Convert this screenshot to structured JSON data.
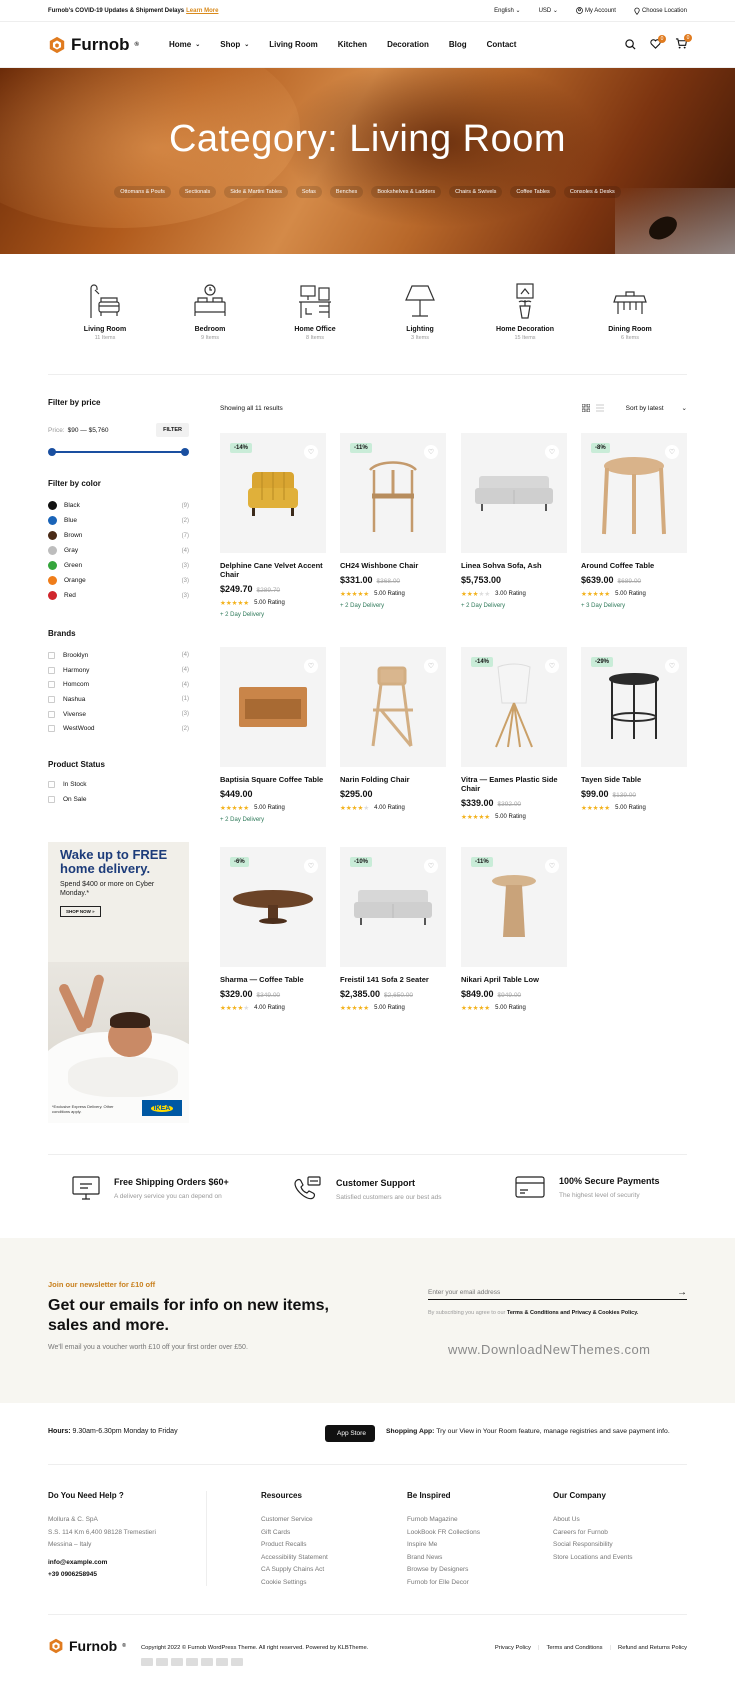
{
  "topbar": {
    "notice": "Furnob's COVID-19 Updates & Shipment Delays",
    "learn_more": "Learn More",
    "language": "English",
    "currency": "USD",
    "account": "My Account",
    "location": "Choose Location"
  },
  "header": {
    "logo": "Furnob",
    "nav": [
      "Home",
      "Shop",
      "Living Room",
      "Kitchen",
      "Decoration",
      "Blog",
      "Contact"
    ],
    "wishlist_count": "0",
    "cart_count": "0"
  },
  "hero": {
    "title": "Category: Living Room",
    "subcategories": [
      "Ottomans & Poufs",
      "Sectionals",
      "Side & Martini Tables",
      "Sofas",
      "Benches",
      "Bookshelves & Ladders",
      "Chairs & Swivels",
      "Coffee Tables",
      "Consoles & Desks"
    ]
  },
  "categories": [
    {
      "name": "Living Room",
      "count": "11 Items",
      "icon": "armchair-lamp-icon"
    },
    {
      "name": "Bedroom",
      "count": "9 Items",
      "icon": "bed-clock-icon"
    },
    {
      "name": "Home Office",
      "count": "8 Items",
      "icon": "desk-icon"
    },
    {
      "name": "Lighting",
      "count": "3 Items",
      "icon": "lamp-icon"
    },
    {
      "name": "Home Decoration",
      "count": "15 Items",
      "icon": "plant-frame-icon"
    },
    {
      "name": "Dining Room",
      "count": "6 Items",
      "icon": "dining-table-icon"
    }
  ],
  "sidebar": {
    "price": {
      "title": "Filter by price",
      "label": "Price:",
      "range": "$90 — $5,760",
      "button": "FILTER",
      "min_fraction": 0.0,
      "max_fraction": 1.0
    },
    "color": {
      "title": "Filter by color",
      "items": [
        {
          "name": "Black",
          "count": "(9)",
          "hex": "#111111"
        },
        {
          "name": "Blue",
          "count": "(2)",
          "hex": "#1a64b8"
        },
        {
          "name": "Brown",
          "count": "(7)",
          "hex": "#4a2b17"
        },
        {
          "name": "Gray",
          "count": "(4)",
          "hex": "#bdbdbd"
        },
        {
          "name": "Green",
          "count": "(3)",
          "hex": "#35a53c"
        },
        {
          "name": "Orange",
          "count": "(3)",
          "hex": "#ef7d1a"
        },
        {
          "name": "Red",
          "count": "(3)",
          "hex": "#d0262d"
        }
      ]
    },
    "brands": {
      "title": "Brands",
      "items": [
        {
          "name": "Brooklyn",
          "count": "(4)"
        },
        {
          "name": "Harmony",
          "count": "(4)"
        },
        {
          "name": "Homcom",
          "count": "(4)"
        },
        {
          "name": "Nashua",
          "count": "(1)"
        },
        {
          "name": "Vivense",
          "count": "(3)"
        },
        {
          "name": "WestWood",
          "count": "(2)"
        }
      ]
    },
    "status": {
      "title": "Product Status",
      "items": [
        "In Stock",
        "On Sale"
      ]
    },
    "banner": {
      "title": "Wake up to FREE home delivery.",
      "text": "Spend $400 or more on Cyber Monday.*",
      "button": "SHOP NOW »",
      "fine_print": "*Exclusive Express Delivery. Other conditions apply.",
      "brand": "IKEA"
    }
  },
  "toolbar": {
    "results": "Showing all 11 results",
    "sort": "Sort by latest"
  },
  "products": [
    {
      "name": "Delphine Cane Velvet Accent Chair",
      "price": "$249.70",
      "old_price": "$289.70",
      "discount": "-14%",
      "rating": 5,
      "rating_text": "5.00 Rating",
      "delivery": "+ 2 Day Delivery",
      "art": "yellow-armchair"
    },
    {
      "name": "CH24 Wishbone Chair",
      "price": "$331.00",
      "old_price": "$368.00",
      "discount": "-11%",
      "rating": 5,
      "rating_text": "5.00 Rating",
      "delivery": "+ 2 Day Delivery",
      "art": "wishbone-chair"
    },
    {
      "name": "Linea Sohva Sofa, Ash",
      "price": "$5,753.00",
      "old_price": "",
      "discount": "",
      "rating": 3,
      "rating_text": "3.00 Rating",
      "delivery": "+ 2 Day Delivery",
      "art": "gray-sofa"
    },
    {
      "name": "Around Coffee Table",
      "price": "$639.00",
      "old_price": "$689.00",
      "discount": "-8%",
      "rating": 5,
      "rating_text": "5.00 Rating",
      "delivery": "+ 3 Day Delivery",
      "art": "round-table"
    },
    {
      "name": "Baptisia Square Coffee Table",
      "price": "$449.00",
      "old_price": "",
      "discount": "",
      "rating": 5,
      "rating_text": "5.00 Rating",
      "delivery": "+ 2 Day Delivery",
      "art": "square-table"
    },
    {
      "name": "Narin Folding Chair",
      "price": "$295.00",
      "old_price": "",
      "discount": "",
      "rating": 4,
      "rating_text": "4.00 Rating",
      "delivery": "",
      "art": "folding-chair"
    },
    {
      "name": "Vitra — Eames Plastic Side Chair",
      "price": "$339.00",
      "old_price": "$392.00",
      "discount": "-14%",
      "rating": 5,
      "rating_text": "5.00 Rating",
      "delivery": "",
      "art": "eames-chair"
    },
    {
      "name": "Tayen Side Table",
      "price": "$99.00",
      "old_price": "$139.00",
      "discount": "-29%",
      "rating": 5,
      "rating_text": "5.00 Rating",
      "delivery": "",
      "art": "side-table"
    },
    {
      "name": "Sharma — Coffee Table",
      "price": "$329.00",
      "old_price": "$349.00",
      "discount": "-6%",
      "rating": 4,
      "rating_text": "4.00 Rating",
      "delivery": "",
      "art": "oval-table"
    },
    {
      "name": "Freistil 141 Sofa 2 Seater",
      "price": "$2,385.00",
      "old_price": "$2,650.00",
      "discount": "-10%",
      "rating": 5,
      "rating_text": "5.00 Rating",
      "delivery": "",
      "art": "gray-sofa"
    },
    {
      "name": "Nikari April Table Low",
      "price": "$849.00",
      "old_price": "$949.00",
      "discount": "-11%",
      "rating": 5,
      "rating_text": "5.00 Rating",
      "delivery": "",
      "art": "wood-stool"
    }
  ],
  "features": [
    {
      "title": "Free Shipping Orders $60+",
      "text": "A delivery service you can depend on",
      "icon": "monitor-icon"
    },
    {
      "title": "Customer Support",
      "text": "Satisfied customers are our best ads",
      "icon": "phone-support-icon"
    },
    {
      "title": "100% Secure Payments",
      "text": "The highest level of security",
      "icon": "credit-card-icon"
    }
  ],
  "newsletter": {
    "kicker": "Join our newsletter for £10 off",
    "title": "Get our emails for info on new items, sales and more.",
    "text": "We'll email you a voucher worth £10 off your first order over £50.",
    "placeholder": "Enter your email address",
    "agree_prefix": "By subscribing you agree to our",
    "agree_links": "Terms & Conditions and Privacy & Cookies Policy.",
    "watermark": "www.DownloadNewThemes.com"
  },
  "info": {
    "hours_label": "Hours:",
    "hours": "9.30am-6.30pm Monday to Friday",
    "app_badge": "App Store",
    "app_label": "Shopping App:",
    "app_text": "Try our View in Your Room feature, manage registries and save payment info."
  },
  "footer": {
    "help": {
      "title": "Do You Need Help ?",
      "lines": [
        "Mollura & C. SpA",
        "S.S. 114 Km 6,400 98128 Tremestieri",
        "Messina – Italy"
      ],
      "email": "info@example.com",
      "phone": "+39 0906258945"
    },
    "resources": {
      "title": "Resources",
      "links": [
        "Customer Service",
        "Gift Cards",
        "Product Recalls",
        "Accessibility Statement",
        "CA Supply Chains Act",
        "Cookie Settings"
      ]
    },
    "inspired": {
      "title": "Be Inspired",
      "links": [
        "Furnob Magazine",
        "LookBook FR Collections",
        "Inspire Me",
        "Brand News",
        "Browse by Designers",
        "Furnob for Elle Decor"
      ]
    },
    "company": {
      "title": "Our Company",
      "links": [
        "About Us",
        "Careers for Furnob",
        "Social Responsibility",
        "Store Locations and Events"
      ]
    },
    "copyright": "Copyright 2022 © Furnob WordPress Theme. All right reserved. Powered by KLBTheme.",
    "legal": [
      "Privacy Policy",
      "Terms and Conditions",
      "Refund and Returns Policy"
    ]
  }
}
